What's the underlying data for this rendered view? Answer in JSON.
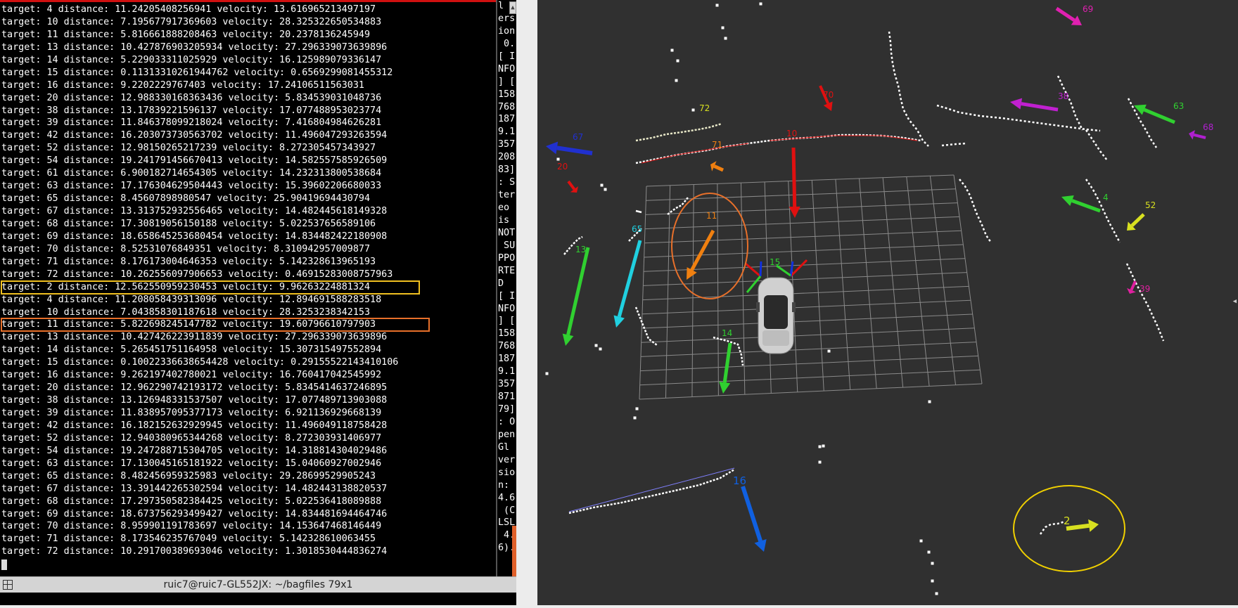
{
  "terminal": {
    "lines": [
      "target: 4 distance: 11.24205408256941 velocity: 13.616965213497197",
      "target: 10 distance: 7.195677917369603 velocity: 28.325322650534883",
      "target: 11 distance: 5.816661888208463 velocity: 20.2378136245949",
      "target: 13 distance: 10.427876903205934 velocity: 27.296339073639896",
      "target: 14 distance: 5.229033311025929 velocity: 16.125989079336147",
      "target: 15 distance: 0.11313310261944762 velocity: 0.6569299081455312",
      "target: 16 distance: 9.2202229767403 velocity: 17.24106511563031",
      "target: 20 distance: 12.988330168363436 velocity: 5.834539031048736",
      "target: 38 distance: 13.17839221596137 velocity: 17.077488953023774",
      "target: 39 distance: 11.846378099218024 velocity: 7.416804984626281",
      "target: 42 distance: 16.203073730563702 velocity: 11.496047293263594",
      "target: 52 distance: 12.98150265217239 velocity: 8.272305457343927",
      "target: 54 distance: 19.241791456670413 velocity: 14.582557585926509",
      "target: 61 distance: 6.900182714654305 velocity: 14.232313800538684",
      "target: 63 distance: 17.176304629504443 velocity: 15.39602206680033",
      "target: 65 distance: 8.45607898980547 velocity: 25.90419694430794",
      "target: 67 distance: 13.313752932556465 velocity: 14.482445618149328",
      "target: 68 distance: 17.30819056150188 velocity: 5.022537656589106",
      "target: 69 distance: 18.658645253680454 velocity: 14.834482422180908",
      "target: 70 distance: 8.52531076849351 velocity: 8.310942957009877",
      "target: 71 distance: 8.176173004646353 velocity: 5.142328613965193",
      "target: 72 distance: 10.262556097906653 velocity: 0.46915283008757963",
      "target: 2 distance: 12.562550959230453 velocity: 9.96263224881324",
      "target: 4 distance: 11.208058439313096 velocity: 12.894691588283518",
      "target: 10 distance: 7.043858301187618 velocity: 28.3253238342153",
      "target: 11 distance: 5.822698245147782 velocity: 19.60796610797903",
      "target: 13 distance: 10.427426223911839 velocity: 27.296339073639896",
      "target: 14 distance: 5.265451751164958 velocity: 15.307315497552894",
      "target: 15 distance: 0.10022336638654428 velocity: 0.29155522143410106",
      "target: 16 distance: 9.262197402780021 velocity: 16.760417042545992",
      "target: 20 distance: 12.962290742193172 velocity: 5.8345414637246895",
      "target: 38 distance: 13.126948331537507 velocity: 17.077489713903088",
      "target: 39 distance: 11.838957095377173 velocity: 6.921136929668139",
      "target: 42 distance: 16.182152632929945 velocity: 11.496049118758428",
      "target: 52 distance: 12.940380965344268 velocity: 8.272303931406977",
      "target: 54 distance: 19.247288715304705 velocity: 14.318814304029486",
      "target: 63 distance: 17.130045165181922 velocity: 15.04060927002946",
      "target: 65 distance: 8.482456959325983 velocity: 29.28699529905243",
      "target: 67 distance: 13.391442265302594 velocity: 14.482443138820537",
      "target: 68 distance: 17.297350582384425 velocity: 5.022536418089888",
      "target: 69 distance: 18.673756293499427 velocity: 14.834481694464746",
      "target: 70 distance: 8.959901191783697 velocity: 14.153647468146449",
      "target: 71 distance: 8.173546235767049 velocity: 5.142328610063455",
      "target: 72 distance: 10.291700389693046 velocity: 1.3018530444836274"
    ],
    "highlight_yellow_index": 22,
    "highlight_orange_index": 25,
    "highlight_colors": {
      "yellow": "#f0c020",
      "orange": "#e8702a"
    }
  },
  "terminal2": {
    "lines": [
      "l w",
      "ers",
      "ion",
      " 0.",
      "[ I",
      "NFO",
      "] [",
      "158",
      "768",
      "187",
      "9.1",
      "357",
      "208",
      "83]",
      ": S",
      "ter",
      "eo ",
      "is ",
      "NOT",
      " SU",
      "PPO",
      "RTE",
      "D  ",
      "[ I",
      "NFO",
      "] [",
      "158",
      "768",
      "187",
      "9.1",
      "357",
      "871",
      "79]",
      ": O",
      "pen",
      "Gl ",
      "ver",
      "sio",
      "n: ",
      "4.6",
      " (C",
      "LSL",
      " 4.",
      "6)."
    ]
  },
  "window": {
    "title": "ruic7@ruic7-GL552JX: ~/bagfiles 79x1",
    "title_icon": "grid-icon"
  },
  "rviz": {
    "background": "#303030",
    "targets": [
      {
        "id": "69",
        "color": "#e020b0"
      },
      {
        "id": "70",
        "color": "#e01010"
      },
      {
        "id": "72",
        "color": "#d8e020"
      },
      {
        "id": "10",
        "color": "#e01010"
      },
      {
        "id": "71",
        "color": "#f08010"
      },
      {
        "id": "67",
        "color": "#2030d0"
      },
      {
        "id": "20",
        "color": "#e01010"
      },
      {
        "id": "38",
        "color": "#c020d0"
      },
      {
        "id": "63",
        "color": "#30d030"
      },
      {
        "id": "68",
        "color": "#b020d0"
      },
      {
        "id": "11",
        "color": "#f08010"
      },
      {
        "id": "65",
        "color": "#20d0e0"
      },
      {
        "id": "13",
        "color": "#30d030"
      },
      {
        "id": "15",
        "color": "#30d030"
      },
      {
        "id": "4",
        "color": "#30d030"
      },
      {
        "id": "52",
        "color": "#d8e020"
      },
      {
        "id": "39",
        "color": "#e020a0"
      },
      {
        "id": "14",
        "color": "#30d030"
      },
      {
        "id": "16",
        "color": "#1060e0"
      },
      {
        "id": "2",
        "color": "#d8e020"
      }
    ],
    "highlight_orange_target": "11",
    "highlight_yellow_target": "2",
    "ego_vehicle": "car-icon"
  }
}
